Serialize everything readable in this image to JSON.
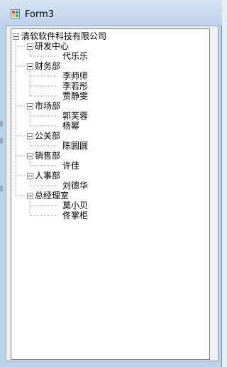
{
  "window": {
    "title": "Form3",
    "icon": "app-icon"
  },
  "tree": {
    "root": {
      "label": "清软软件科技有限公司",
      "groups": [
        {
          "label": "研发中心",
          "members": [
            "代乐乐"
          ]
        },
        {
          "label": "财务部",
          "members": [
            "李师师",
            "李若彤",
            "贾静雯"
          ]
        },
        {
          "label": "市场部",
          "members": [
            "郭芙蓉",
            "杨幂"
          ]
        },
        {
          "label": "公关部",
          "members": [
            "陈圆圆"
          ]
        },
        {
          "label": "销售部",
          "members": [
            "许佳"
          ]
        },
        {
          "label": "人事部",
          "members": [
            "刘德华"
          ]
        },
        {
          "label": "总经理室",
          "members": [
            "莫小贝",
            "佟掌柜"
          ]
        }
      ]
    }
  },
  "colors": {
    "tree_background": "#ffffff",
    "window_frame": "#bcd1ea"
  }
}
